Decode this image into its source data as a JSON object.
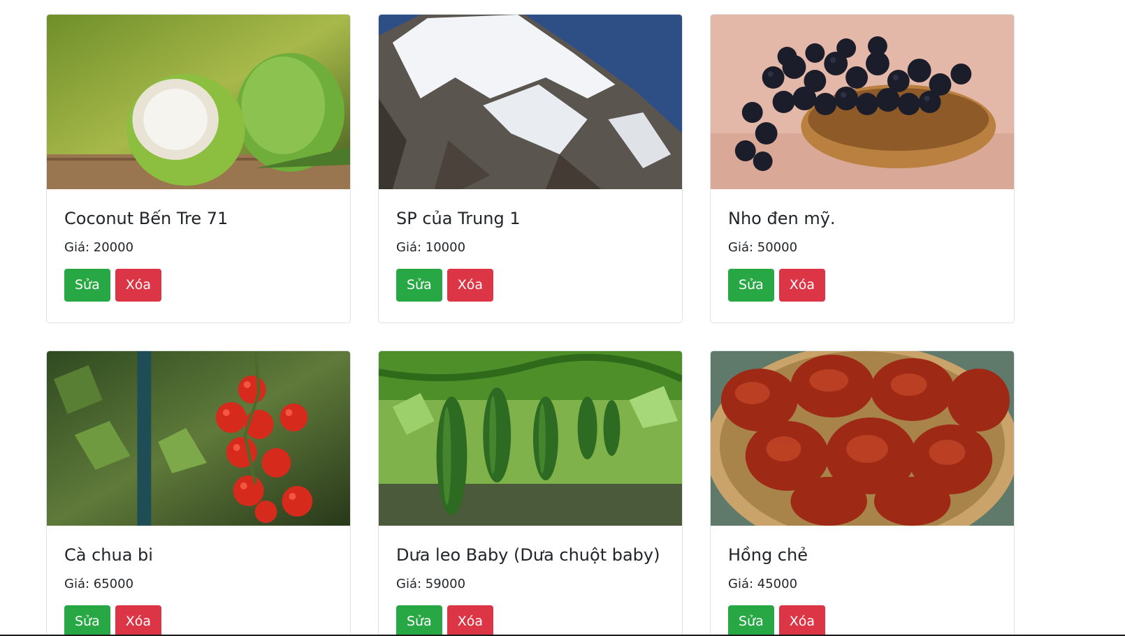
{
  "colors": {
    "edit_button": "#28a745",
    "delete_button": "#dc3545"
  },
  "products": [
    {
      "name": "Coconut Bến Tre 71",
      "price": "Giá: 20000",
      "edit_label": "Sửa",
      "delete_label": "Xóa",
      "image": "coconut-image"
    },
    {
      "name": "SP của Trung 1",
      "price": "Giá: 10000",
      "edit_label": "Sửa",
      "delete_label": "Xóa",
      "image": "snowy-mountain-image"
    },
    {
      "name": "Nho đen mỹ.",
      "price": "Giá: 50000",
      "edit_label": "Sửa",
      "delete_label": "Xóa",
      "image": "black-grapes-image"
    },
    {
      "name": "Cà chua bi",
      "price": "Giá: 65000",
      "edit_label": "Sửa",
      "delete_label": "Xóa",
      "image": "cherry-tomatoes-image"
    },
    {
      "name": "Dưa leo Baby (Dưa chuột baby)",
      "price": "Giá: 59000",
      "edit_label": "Sửa",
      "delete_label": "Xóa",
      "image": "cucumbers-image"
    },
    {
      "name": "Hồng chẻ",
      "price": "Giá: 45000",
      "edit_label": "Sửa",
      "delete_label": "Xóa",
      "image": "dried-persimmon-image"
    }
  ]
}
